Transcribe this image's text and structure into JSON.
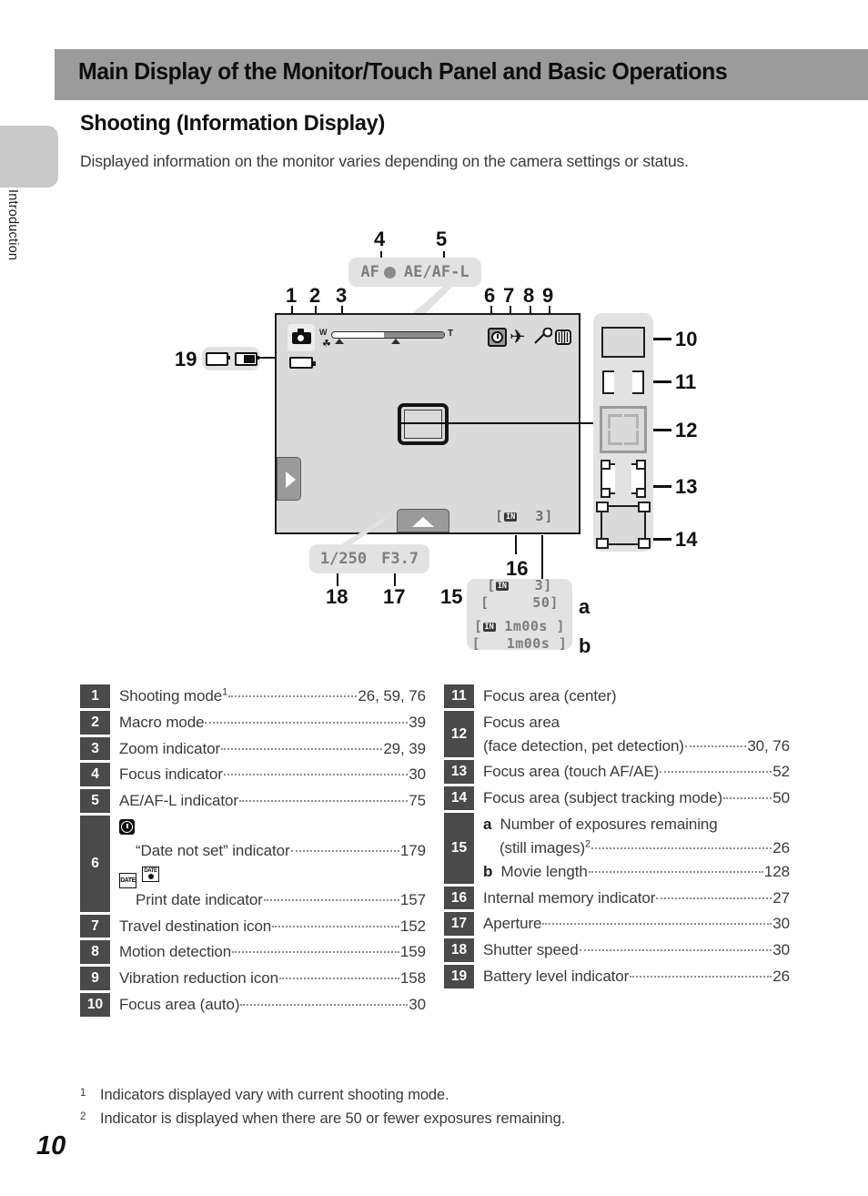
{
  "page": {
    "side_label": "Introduction",
    "page_number": "10",
    "header_title": "Main Display of the Monitor/Touch Panel and Basic Operations",
    "section_title": "Shooting (Information Display)",
    "intro_text": "Displayed information on the monitor varies depending on the camera settings or status.",
    "colors": {
      "header_bar": "#9b9b9b",
      "number_box": "#4a4a4a",
      "monitor_screen": "#dadada",
      "bubble": "#e2e2e2",
      "lcd_text": "#7d7d7d"
    }
  },
  "figure": {
    "callout_numbers": [
      "1",
      "2",
      "3",
      "4",
      "5",
      "6",
      "7",
      "8",
      "9",
      "10",
      "11",
      "12",
      "13",
      "14",
      "15",
      "16",
      "17",
      "18",
      "19"
    ],
    "sub_labels": [
      "a",
      "b"
    ],
    "af_bubble": {
      "af_label": "AF",
      "ae_af_l_label": "AE/AF-L"
    },
    "exposure_bubble": {
      "shutter": "1/250",
      "aperture": "F3.7"
    },
    "monitor": {
      "zoom_wide": "W",
      "zoom_tele": "T",
      "memory_badge": "IN",
      "remaining": "3",
      "bracket_open": "[",
      "bracket_close": "]"
    },
    "counts_bubble": {
      "line_a1": {
        "badge": "IN",
        "value": "3"
      },
      "line_a2": {
        "badge": "",
        "value": "50"
      },
      "line_b1": {
        "badge": "IN",
        "value": "1m00s"
      },
      "line_b2": {
        "badge": "",
        "value": "1m00s"
      }
    },
    "rail_items": [
      {
        "num": "10",
        "name": "focus-area-auto"
      },
      {
        "num": "11",
        "name": "focus-area-center"
      },
      {
        "num": "12",
        "name": "focus-area-face-detection"
      },
      {
        "num": "13",
        "name": "focus-area-touch-af-ae"
      },
      {
        "num": "14",
        "name": "focus-area-subject-tracking"
      }
    ]
  },
  "legend": {
    "left": [
      {
        "num": "1",
        "lines": [
          {
            "name": "Shooting mode",
            "sup": "1",
            "page": "26, 59, 76"
          }
        ]
      },
      {
        "num": "2",
        "lines": [
          {
            "name": "Macro mode",
            "page": "39"
          }
        ]
      },
      {
        "num": "3",
        "lines": [
          {
            "name": "Zoom indicator",
            "page": "29, 39"
          }
        ]
      },
      {
        "num": "4",
        "lines": [
          {
            "name": "Focus indicator",
            "page": "30"
          }
        ]
      },
      {
        "num": "5",
        "lines": [
          {
            "name": "AE/AF-L indicator",
            "page": "75"
          }
        ]
      },
      {
        "num": "6",
        "lines": [
          {
            "icon": "clock-icon"
          },
          {
            "name": "“Date not set” indicator",
            "page": "179",
            "indent": true
          },
          {
            "icon": "print-date-icons"
          },
          {
            "name": "Print date indicator",
            "page": "157",
            "indent": true
          }
        ]
      },
      {
        "num": "7",
        "lines": [
          {
            "name": "Travel destination icon",
            "page": "152"
          }
        ]
      },
      {
        "num": "8",
        "lines": [
          {
            "name": "Motion detection",
            "page": "159"
          }
        ]
      },
      {
        "num": "9",
        "lines": [
          {
            "name": "Vibration reduction icon",
            "page": "158"
          }
        ]
      },
      {
        "num": "10",
        "lines": [
          {
            "name": "Focus area (auto)",
            "page": "30"
          }
        ]
      }
    ],
    "right": [
      {
        "num": "11",
        "lines": [
          {
            "name": "Focus area (center)",
            "page": ""
          }
        ]
      },
      {
        "num": "12",
        "lines": [
          {
            "name": "Focus area",
            "page": ""
          },
          {
            "name": "(face detection, pet detection)",
            "page": "30, 76"
          }
        ]
      },
      {
        "num": "13",
        "lines": [
          {
            "name": "Focus area (touch AF/AE)",
            "page": "52"
          }
        ]
      },
      {
        "num": "14",
        "lines": [
          {
            "name": "Focus area (subject tracking mode)",
            "page": "50"
          }
        ]
      },
      {
        "num": "15",
        "lines": [
          {
            "bold": "a",
            "name": "Number of exposures remaining",
            "page": ""
          },
          {
            "name": "(still images)",
            "sup": "2",
            "page": "26",
            "indent": true
          },
          {
            "bold": "b",
            "name": "Movie length",
            "page": "128"
          }
        ]
      },
      {
        "num": "16",
        "lines": [
          {
            "name": "Internal memory indicator",
            "page": "27"
          }
        ]
      },
      {
        "num": "17",
        "lines": [
          {
            "name": "Aperture",
            "page": "30"
          }
        ]
      },
      {
        "num": "18",
        "lines": [
          {
            "name": "Shutter speed",
            "page": "30"
          }
        ]
      },
      {
        "num": "19",
        "lines": [
          {
            "name": "Battery level indicator",
            "page": "26"
          }
        ]
      }
    ]
  },
  "footnotes": [
    {
      "marker": "1",
      "text": "Indicators displayed vary with current shooting mode."
    },
    {
      "marker": "2",
      "text": "Indicator is displayed when there are 50 or fewer exposures remaining."
    }
  ]
}
